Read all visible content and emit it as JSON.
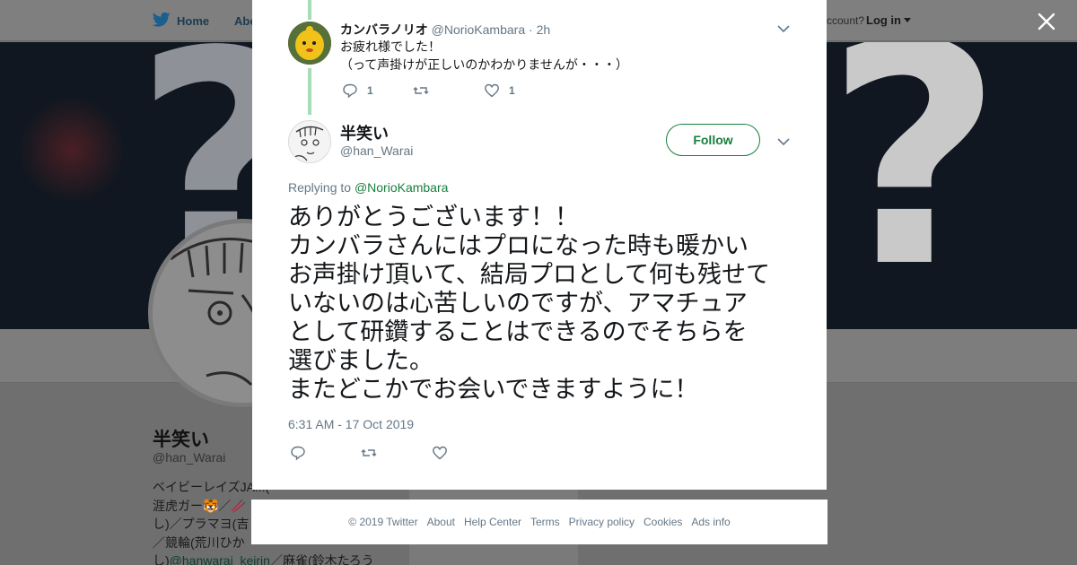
{
  "background": {
    "nav": {
      "home_label": "Home",
      "about_label": "Abo",
      "account_text": "ccount?",
      "login_label": "Log in"
    },
    "profile": {
      "name": "半笑い",
      "handle": "@han_Warai",
      "bio_lines": [
        "ベイビーレイズJA...(",
        "涯虎ガー🐯／🥢",
        "し)／プラマヨ(吉",
        "／競輪(荒川ひか",
        "し)",
        "／麻雀(鈴木たろう"
      ],
      "bio_link": "@hanwarai_keirin"
    }
  },
  "modal": {
    "reply": {
      "name": "カンバラノリオ",
      "handle": "@NorioKambara",
      "separator": " · ",
      "time": "2h",
      "text": "お疲れ様でした！\n（って声掛けが正しいのかわかりませんが・・・）",
      "reply_count": "1",
      "like_count": "1"
    },
    "main": {
      "name": "半笑い",
      "handle": "@han_Warai",
      "follow_label": "Follow",
      "replying_prefix": "Replying to ",
      "replying_to": "@NorioKambara",
      "text": "ありがとうございます！！\nカンバラさんにはプロになった時も暖かい\nお声掛け頂いて、結局プロとして何も残せて\nいないのは心苦しいのですが、アマチュア\nとして研鑽することはできるのでそちらを\n選びました。\nまたどこかでお会いできますように！",
      "timestamp": "6:31 AM - 17 Oct 2019"
    }
  },
  "footer": {
    "copyright": "© 2019 Twitter",
    "links": [
      "About",
      "Help Center",
      "Terms",
      "Privacy policy",
      "Cookies",
      "Ads info"
    ]
  },
  "icons": {
    "close": "close-icon",
    "reply": "reply-icon",
    "retweet": "retweet-icon",
    "like": "heart-icon",
    "caret": "chevron-down-icon",
    "brand": "twitter-bird-icon"
  },
  "colors": {
    "accent": "#17803d",
    "thread_line": "#a6dcb6",
    "muted_text": "#657786",
    "overlay": "#6f6f6f"
  }
}
